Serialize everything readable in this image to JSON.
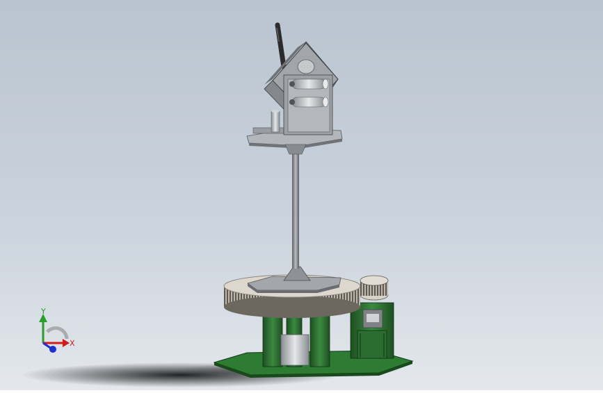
{
  "viewport": {
    "background_top": "#b8c3cf",
    "background_bottom": "#dfe4ea"
  },
  "model": {
    "metal_color": "#9b9fa3",
    "metal_dark": "#5e6266",
    "gear_color": "#d9d3c9",
    "gear_teeth_color": "#8a857c",
    "pcb_color": "#2f7a34",
    "pcb_dark": "#1c4d20",
    "antenna_color": "#2b2b2b"
  },
  "triad": {
    "x_label": "X",
    "y_label": "Y",
    "x_color": "#d21b1b",
    "y_color": "#2a9d2a",
    "z_color": "#1b2fd2"
  }
}
